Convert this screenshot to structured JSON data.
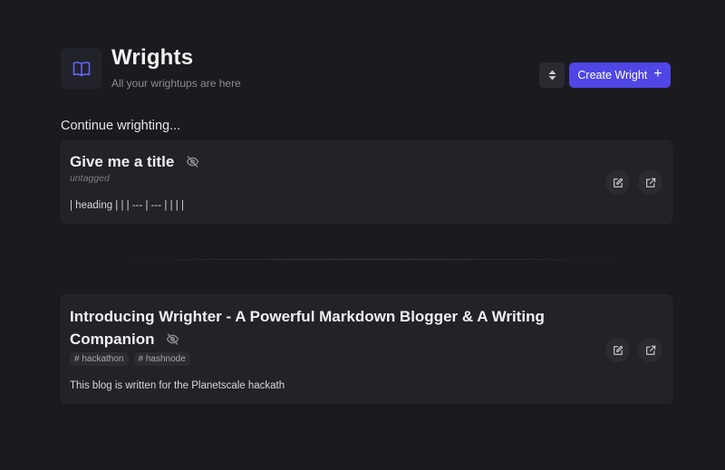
{
  "header": {
    "title": "Wrights",
    "subtitle": "All your wrightups are here",
    "icon": "book-icon",
    "create_label": "Create Wright",
    "create_icon": "plus",
    "sort_icon": "sort-icon"
  },
  "section": {
    "heading": "Continue wrighting..."
  },
  "cards": [
    {
      "title": "Give me a title",
      "tag_placeholder": "untagged",
      "tags": [],
      "excerpt": "| heading | | | --- | --- | | | |",
      "visibility_icon": "eye-off-icon"
    },
    {
      "title": "Introducing Wrighter - A Powerful Markdown Blogger & A Writing Companion",
      "tags": [
        "# hackathon",
        "# hashnode"
      ],
      "excerpt": "This blog is written for the Planetscale hackath",
      "visibility_icon": "eye-off-icon"
    }
  ],
  "colors": {
    "background": "#1b1b1f",
    "card": "#222227",
    "accent": "#4f46e5",
    "icon_accent": "#6366f1"
  }
}
